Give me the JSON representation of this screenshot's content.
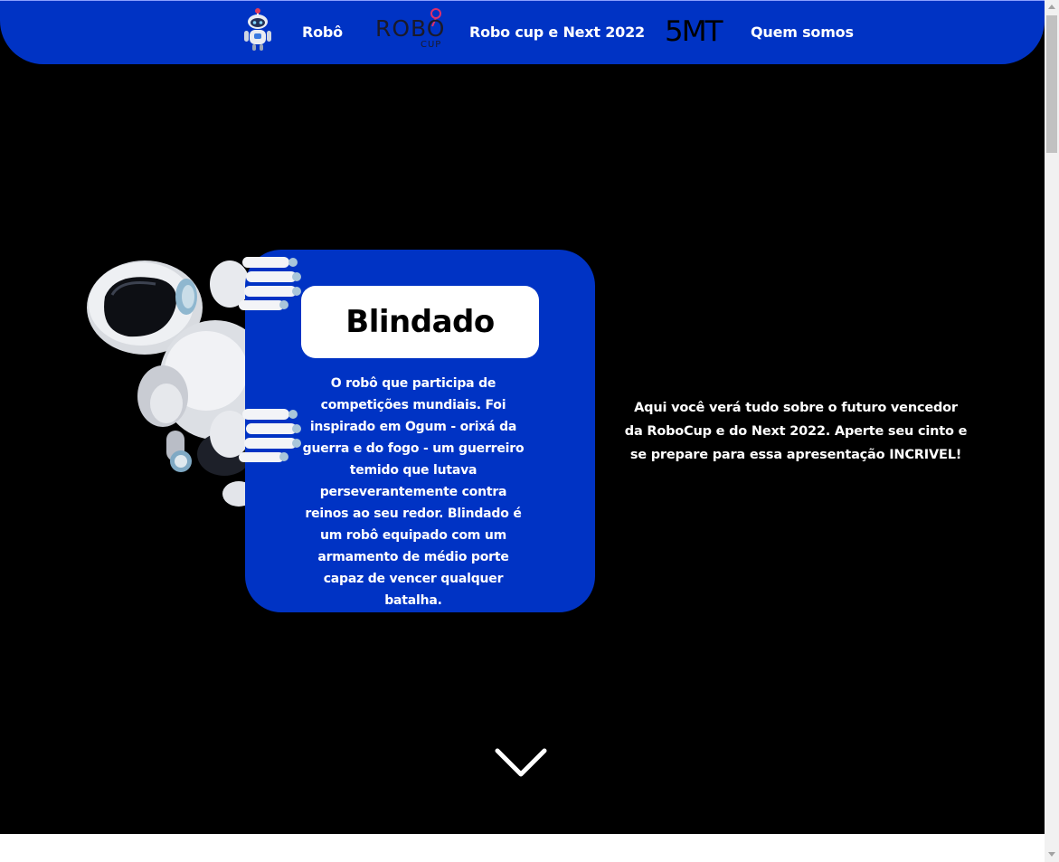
{
  "nav": {
    "robot_icon": "robot-mascot-icon",
    "robo_label": "Robô",
    "robocup_logo": {
      "main": "ROBO",
      "sub": "CUP"
    },
    "robocup_label": "Robo cup e Next 2022",
    "smt_logo": "5MT",
    "about_label": "Quem somos"
  },
  "card": {
    "title": "Blindado",
    "description": "O robô que participa de competições mundiais. Foi inspirado em Ogum - orixá da guerra e do fogo - um guerreiro temido que lutava perseverantemente contra reinos ao seu redor. Blindado é um robô equipado com um armamento de médio porte capaz de vencer qualquer batalha."
  },
  "intro": {
    "text": "Aqui você verá tudo sobre o futuro vencedor da RoboCup e do Next 2022. Aperte seu cinto e se prepare para essa apresentação INCRIVEL!"
  },
  "icons": {
    "scroll_down": "chevron-down-icon",
    "robot_image": "robot-peeking-image"
  },
  "colors": {
    "brand_blue": "#0033c4",
    "background": "#000000",
    "logo_accent": "#e0306a"
  }
}
